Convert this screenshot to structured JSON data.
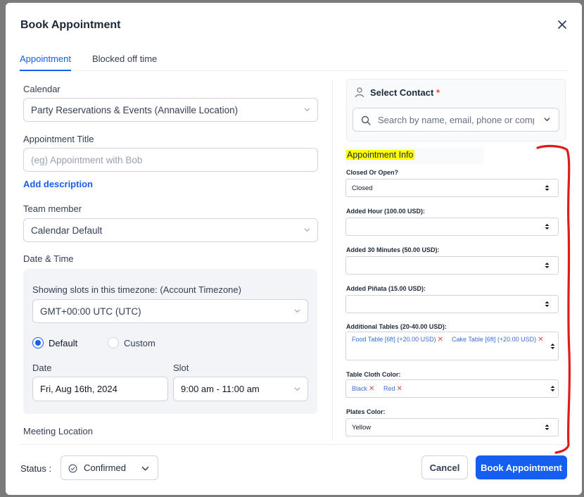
{
  "modal": {
    "title": "Book Appointment",
    "tabs": [
      {
        "label": "Appointment",
        "active": true
      },
      {
        "label": "Blocked off time",
        "active": false
      }
    ]
  },
  "form": {
    "calendar_label": "Calendar",
    "calendar_value": "Party Reservations & Events (Annaville Location)",
    "title_label": "Appointment Title",
    "title_placeholder": "(eg) Appointment with Bob",
    "add_description": "Add description",
    "team_label": "Team member",
    "team_value": "Calendar Default",
    "datetime_label": "Date & Time",
    "timezone_label": "Showing slots in this timezone: (Account Timezone)",
    "timezone_value": "GMT+00:00 UTC (UTC)",
    "radio_default": "Default",
    "radio_custom": "Custom",
    "date_label": "Date",
    "date_value": "Fri, Aug 16th, 2024",
    "slot_label": "Slot",
    "slot_value": "9:00 am - 11:00 am",
    "meeting_location_label": "Meeting Location"
  },
  "contact": {
    "label": "Select Contact",
    "required_mark": "*",
    "search_placeholder": "Search by name, email, phone or comp"
  },
  "info": {
    "heading": "Appointment Info",
    "closed_open_label": "Closed Or Open?",
    "closed_open_value": "Closed",
    "added_hour_label": "Added Hour (100.00 USD):",
    "added_hour_value": "",
    "added_30_label": "Added 30 Minutes (50.00 USD):",
    "added_30_value": "",
    "pinata_label": "Added Piñata (15.00 USD):",
    "pinata_value": "",
    "tables_label": "Additional Tables (20-40.00 USD):",
    "tables_tags": [
      "Food Table [6ft] (+20.00 USD)",
      "Cake Table [6ft] (+20.00 USD)"
    ],
    "cloth_label": "Table Cloth Color:",
    "cloth_tags": [
      "Black",
      "Red"
    ],
    "plates_label": "Plates Color:",
    "plates_value": "Yellow",
    "remove_glyph": "✕"
  },
  "footer": {
    "status_label": "Status :",
    "status_value": "Confirmed",
    "cancel_label": "Cancel",
    "book_label": "Book Appointment"
  },
  "colors": {
    "accent": "#155eef",
    "highlight": "#ffff00",
    "annotation": "#e01b1b"
  }
}
